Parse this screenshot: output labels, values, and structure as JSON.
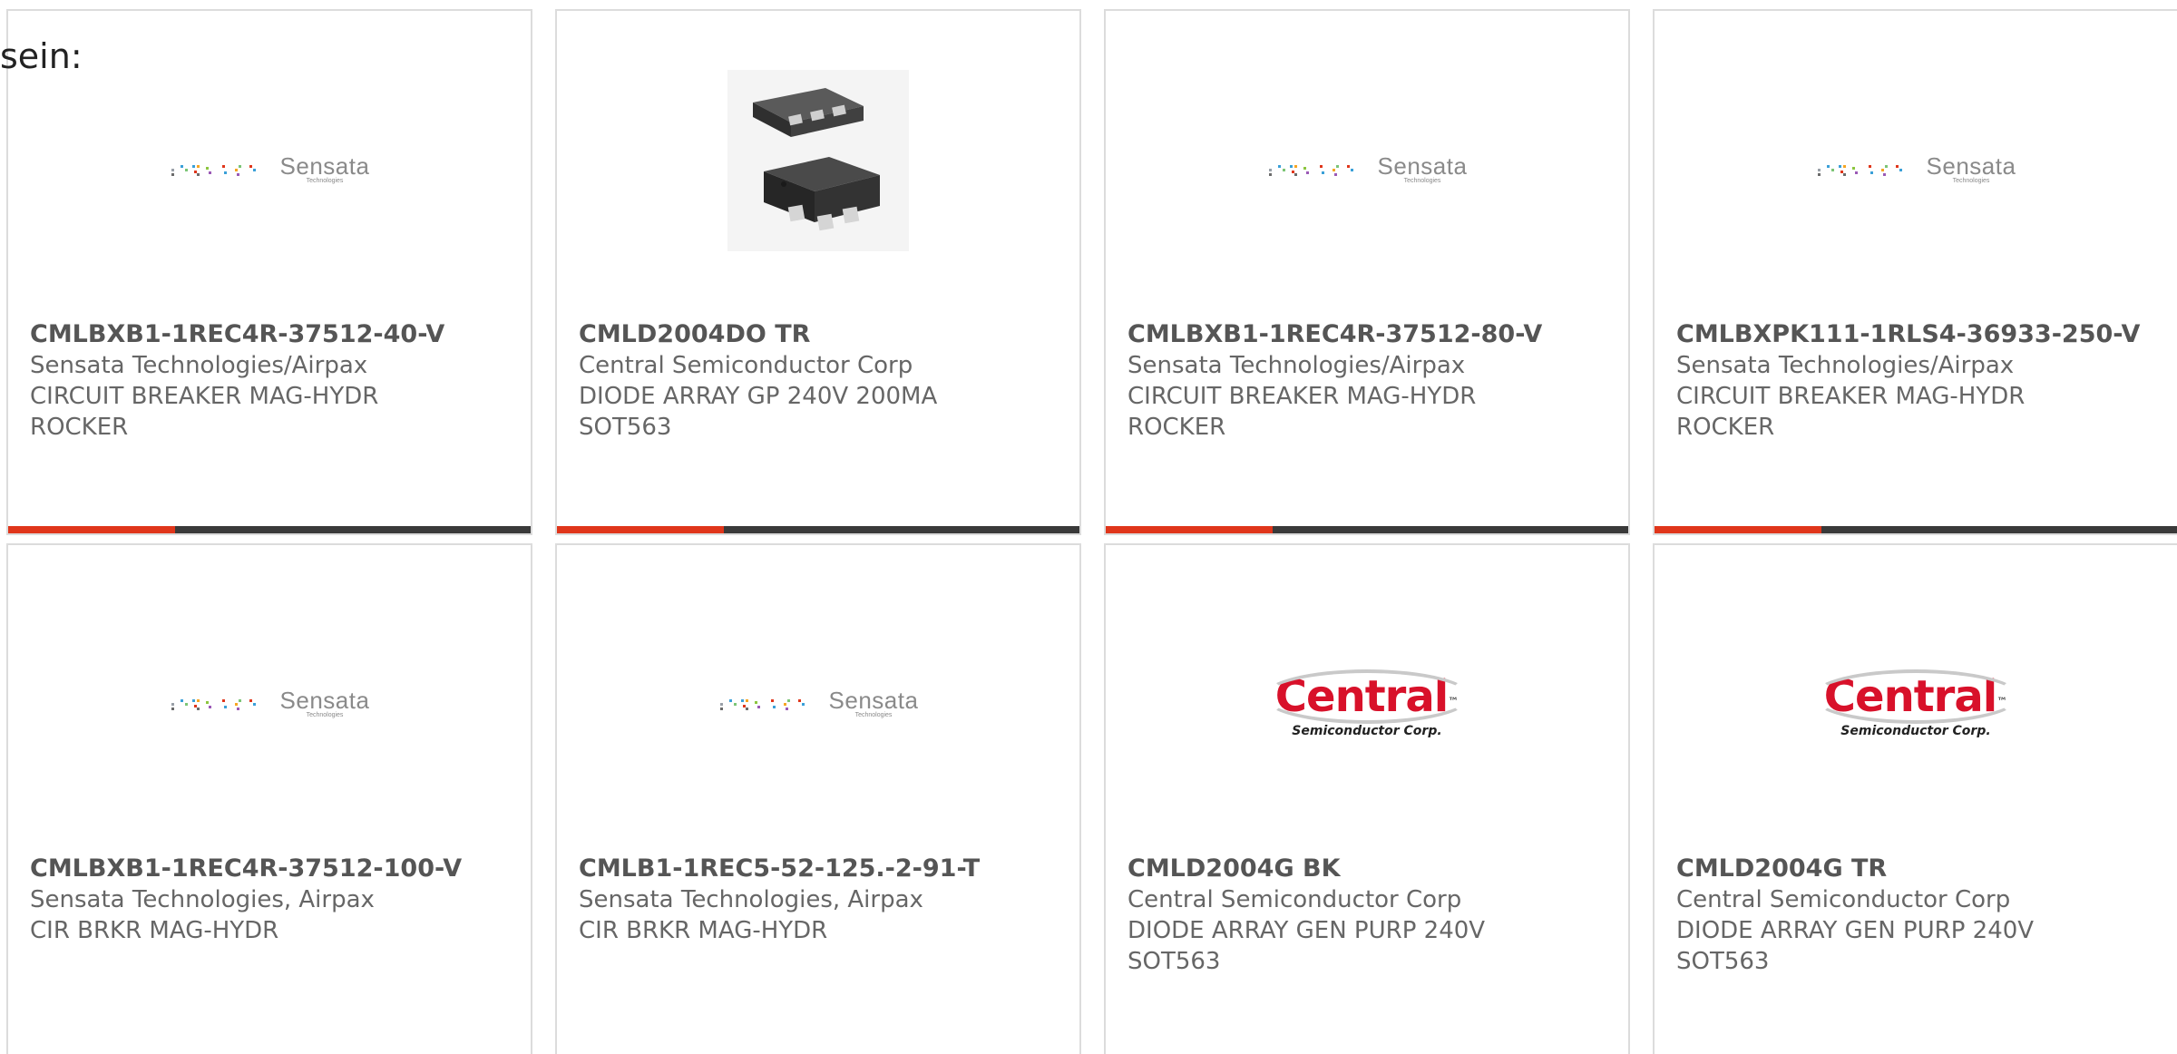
{
  "intro_text": "sein:",
  "colors": {
    "accent_bar": "#e0361b",
    "dark_bar": "#3a3a3a",
    "card_border": "#dcdcdc",
    "central_red": "#d8112a"
  },
  "products": [
    {
      "part_number": "CMLBXB1-1REC4R-37512-40-V",
      "manufacturer": "Sensata Technologies/Airpax",
      "description": "CIRCUIT BREAKER MAG-HYDR ROCKER",
      "image": "sensata-logo",
      "has_bar": true
    },
    {
      "part_number": "CMLD2004DO TR",
      "manufacturer": "Central Semiconductor Corp",
      "description": "DIODE ARRAY GP 240V 200MA SOT563",
      "image": "sot563-package-photo",
      "has_bar": true
    },
    {
      "part_number": "CMLBXB1-1REC4R-37512-80-V",
      "manufacturer": "Sensata Technologies/Airpax",
      "description": "CIRCUIT BREAKER MAG-HYDR ROCKER",
      "image": "sensata-logo",
      "has_bar": true
    },
    {
      "part_number": "CMLBXPK111-1RLS4-36933-250-V",
      "manufacturer": "Sensata Technologies/Airpax",
      "description": "CIRCUIT BREAKER MAG-HYDR ROCKER",
      "image": "sensata-logo",
      "has_bar": true
    },
    {
      "part_number": "CMLBXB1-1REC4R-37512-100-V",
      "manufacturer": "Sensata Technologies, Airpax",
      "description": "CIR BRKR MAG-HYDR",
      "image": "sensata-logo",
      "has_bar": false
    },
    {
      "part_number": "CMLB1-1REC5-52-125.-2-91-T",
      "manufacturer": "Sensata Technologies, Airpax",
      "description": "CIR BRKR MAG-HYDR",
      "image": "sensata-logo",
      "has_bar": false
    },
    {
      "part_number": "CMLD2004G BK",
      "manufacturer": "Central Semiconductor Corp",
      "description": "DIODE ARRAY GEN PURP 240V SOT563",
      "image": "central-logo",
      "has_bar": false
    },
    {
      "part_number": "CMLD2004G TR",
      "manufacturer": "Central Semiconductor Corp",
      "description": "DIODE ARRAY GEN PURP 240V SOT563",
      "image": "central-logo",
      "has_bar": false
    }
  ],
  "logos": {
    "sensata_word": "Sensata",
    "sensata_sub": "Technologies",
    "central_word": "Central",
    "central_sub": "Semiconductor Corp.",
    "central_tm": "™"
  }
}
